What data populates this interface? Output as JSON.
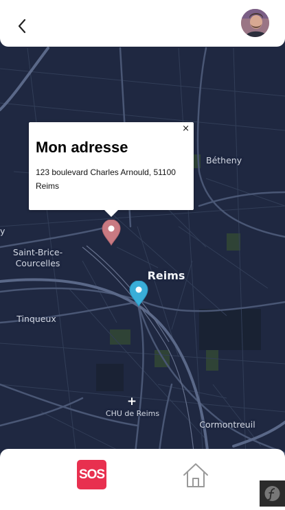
{
  "map": {
    "popup": {
      "title": "Mon adresse",
      "address": "123 boulevard Charles Arnould, 51100 Reims",
      "close": "×"
    },
    "labels": {
      "betheny": "Bétheny",
      "saint_brice": "Saint-Brice-\nCourcelles",
      "reims": "Reims",
      "tinqueux": "Tinqueux",
      "chu": "CHU de Reims",
      "cormontreuil": "Cormontreuil",
      "edge": "y"
    },
    "colors": {
      "background": "#1f2841",
      "road": "#4a5775",
      "address_marker": "#c97a82",
      "location_marker": "#3aaed8"
    }
  },
  "header": {
    "back_icon": "chevron-left-icon",
    "avatar": "user-avatar"
  },
  "footer": {
    "sos_label": "SOS",
    "sos_color": "#e8304f",
    "home_icon": "home-icon"
  }
}
